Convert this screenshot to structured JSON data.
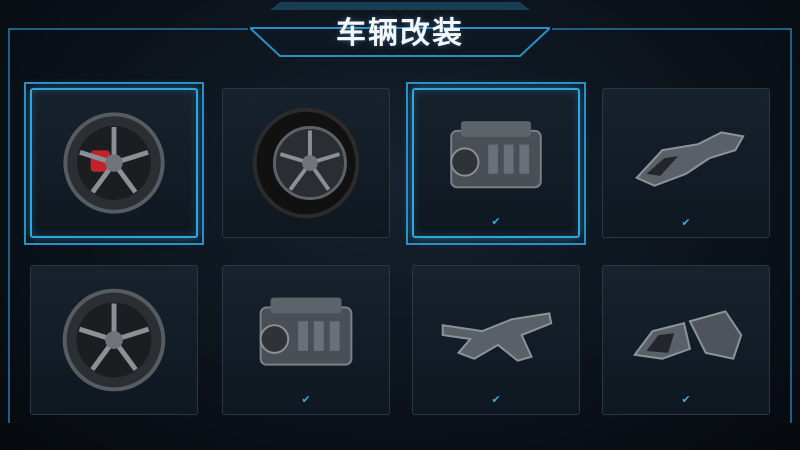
{
  "header": {
    "title": "车辆改装"
  },
  "colors": {
    "accent": "#2fa6e0",
    "check": "#3aa6e6",
    "card_bg": "#131d27"
  },
  "cards": [
    {
      "part": "wheel-red-caliper",
      "icon": "wheel-icon",
      "selected": true,
      "checked": false
    },
    {
      "part": "tire-wheel",
      "icon": "tire-icon",
      "selected": false,
      "checked": false
    },
    {
      "part": "engine",
      "icon": "engine-icon",
      "selected": true,
      "checked": true
    },
    {
      "part": "chassis-frame",
      "icon": "frame-icon",
      "selected": false,
      "checked": true
    },
    {
      "part": "wheel",
      "icon": "wheel-icon",
      "selected": false,
      "checked": false
    },
    {
      "part": "engine",
      "icon": "engine-icon",
      "selected": false,
      "checked": true
    },
    {
      "part": "cross-member",
      "icon": "crossmember-icon",
      "selected": false,
      "checked": true
    },
    {
      "part": "body-panel",
      "icon": "body-panel-icon",
      "selected": false,
      "checked": true
    }
  ],
  "check_mark": "✔"
}
